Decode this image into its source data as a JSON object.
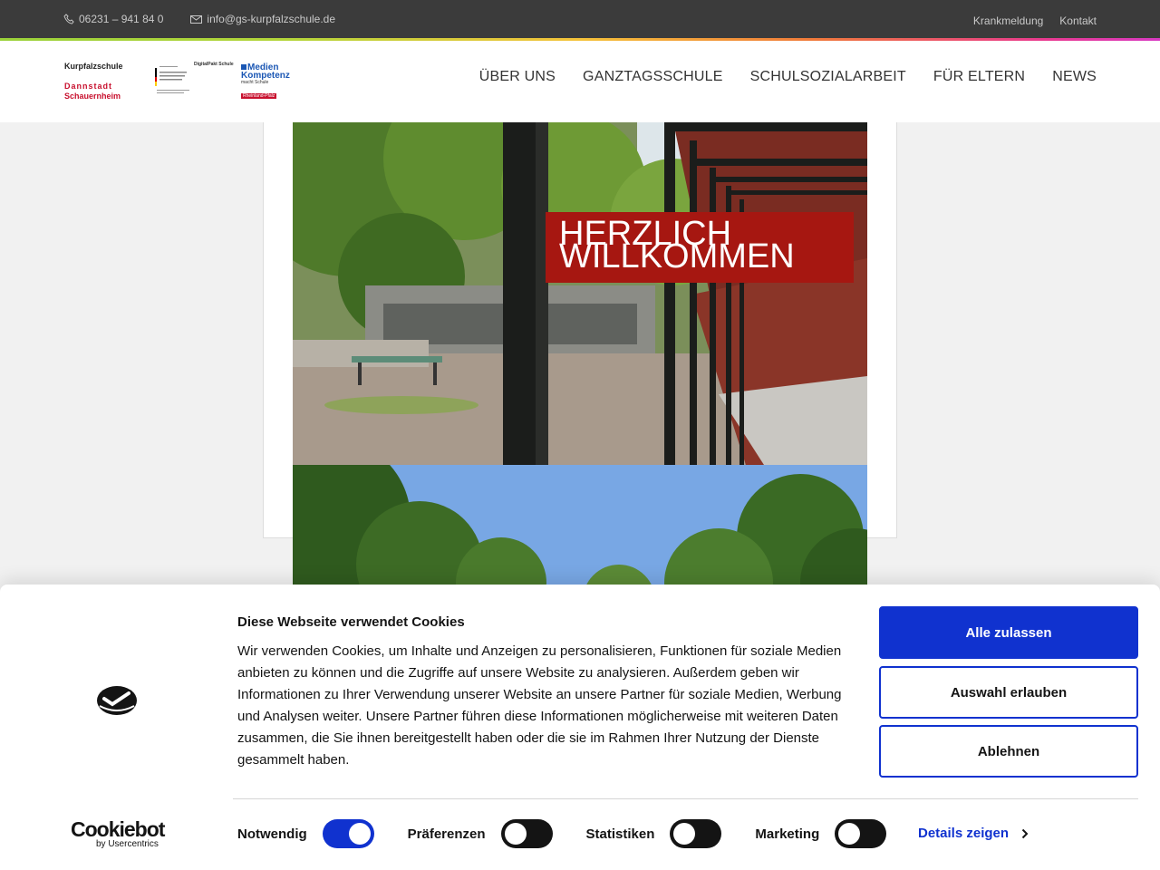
{
  "topbar": {
    "phone": "06231 – 941 84 0",
    "email": "info@gs-kurpfalzschule.de",
    "links": [
      "Krankmeldung",
      "Kontakt"
    ]
  },
  "logos": {
    "school_name": "Kurpfalzschule",
    "town1": "Dannstadt",
    "town2": "Schauernheim",
    "digital": "DigitalPakt Schule",
    "medien1": "Medien",
    "medien2": "Kompetenz",
    "medien3": "macht Schule",
    "medien4": "Rheinland-Pfalz"
  },
  "nav": [
    "ÜBER UNS",
    "GANZTAGSSCHULE",
    "SCHULSOZIALARBEIT",
    "FÜR ELTERN",
    "NEWS"
  ],
  "hero": {
    "line1": "HERZLICH",
    "line2": "WILLKOMMEN"
  },
  "cookie": {
    "title": "Diese Webseite verwendet Cookies",
    "text": "Wir verwenden Cookies, um Inhalte und Anzeigen zu personalisieren, Funktionen für soziale Medien anbieten zu können und die Zugriffe auf unsere Website zu analysieren. Außerdem geben wir Informationen zu Ihrer Verwendung unserer Website an unsere Partner für soziale Medien, Werbung und Analysen weiter. Unsere Partner führen diese Informationen möglicherweise mit weiteren Daten zusammen, die Sie ihnen bereitgestellt haben oder die sie im Rahmen Ihrer Nutzung der Dienste gesammelt haben.",
    "btn_allow_all": "Alle zulassen",
    "btn_allow_selection": "Auswahl erlauben",
    "btn_deny": "Ablehnen",
    "toggles": [
      {
        "label": "Notwendig",
        "on": true
      },
      {
        "label": "Präferenzen",
        "on": false
      },
      {
        "label": "Statistiken",
        "on": false
      },
      {
        "label": "Marketing",
        "on": false
      }
    ],
    "details": "Details zeigen",
    "brand": "Cookiebot",
    "brand_sub": "by Usercentrics",
    "accent": "#1032cf"
  }
}
